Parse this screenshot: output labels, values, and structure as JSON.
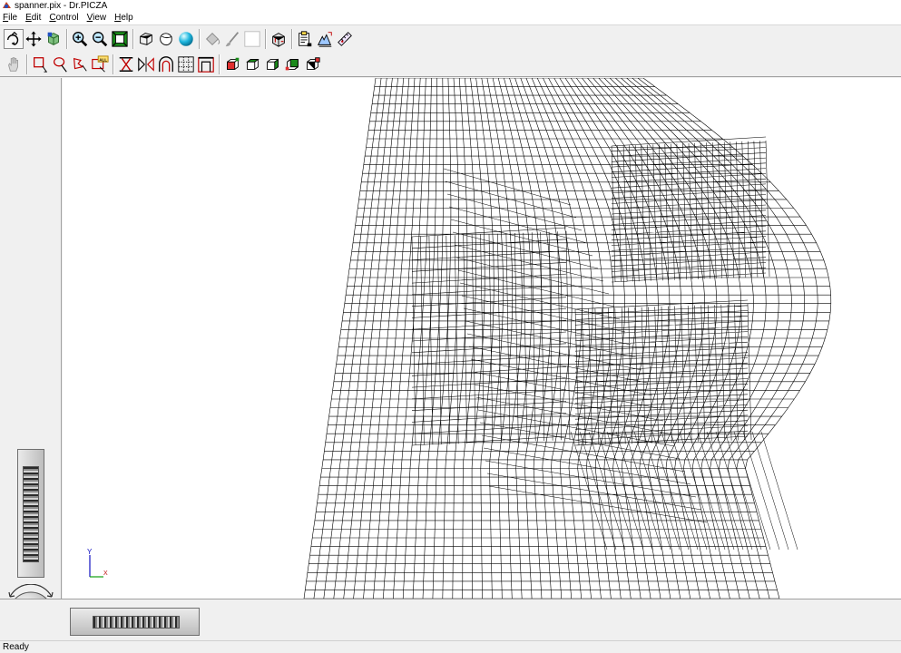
{
  "window": {
    "title": "spanner.pix - Dr.PICZA"
  },
  "menu": [
    "File",
    "Edit",
    "Control",
    "View",
    "Help"
  ],
  "toolbar": {
    "row1": [
      {
        "icon": "rotate-icon"
      },
      {
        "icon": "pan-move-icon"
      },
      {
        "icon": "object-3d-icon"
      },
      {
        "sep": true
      },
      {
        "icon": "zoom-in-icon"
      },
      {
        "icon": "zoom-out-icon"
      },
      {
        "icon": "zoom-fit-icon"
      },
      {
        "sep": true
      },
      {
        "icon": "wireframe-icon"
      },
      {
        "icon": "hidden-line-icon"
      },
      {
        "icon": "shaded-sphere-icon"
      },
      {
        "sep": true
      },
      {
        "icon": "paint-bucket-icon",
        "disabled": true
      },
      {
        "icon": "brush-icon",
        "disabled": true
      },
      {
        "icon": "blank-icon",
        "disabled": true
      },
      {
        "sep": true
      },
      {
        "icon": "view-cube-icon"
      },
      {
        "sep": true
      },
      {
        "icon": "clipboard-export-icon"
      },
      {
        "icon": "scan-settings-icon"
      },
      {
        "icon": "ruler-icon"
      }
    ],
    "row2": [
      {
        "icon": "hand-icon",
        "disabled": true
      },
      {
        "sep": true
      },
      {
        "icon": "rect-select-icon"
      },
      {
        "icon": "lasso-select-icon"
      },
      {
        "icon": "polygon-select-icon"
      },
      {
        "icon": "select-all-icon",
        "badge": "ALL"
      },
      {
        "sep": true
      },
      {
        "icon": "cut-mesh-icon"
      },
      {
        "icon": "mirror-icon"
      },
      {
        "icon": "arch-icon"
      },
      {
        "icon": "grid-select-icon"
      },
      {
        "icon": "frame-icon"
      },
      {
        "sep": true
      },
      {
        "icon": "view-front-icon"
      },
      {
        "icon": "view-top-icon"
      },
      {
        "icon": "view-side-icon"
      },
      {
        "icon": "view-back-icon"
      },
      {
        "icon": "view-iso-icon"
      }
    ]
  },
  "axes": {
    "y_label": "Y",
    "x_label": "X"
  },
  "status": {
    "text": "Ready"
  },
  "colors": {
    "background": "#f0f0f0",
    "viewport": "#ffffff",
    "mesh": "#000000",
    "select_red": "#c00000",
    "accent_green": "#1a8a1a"
  }
}
